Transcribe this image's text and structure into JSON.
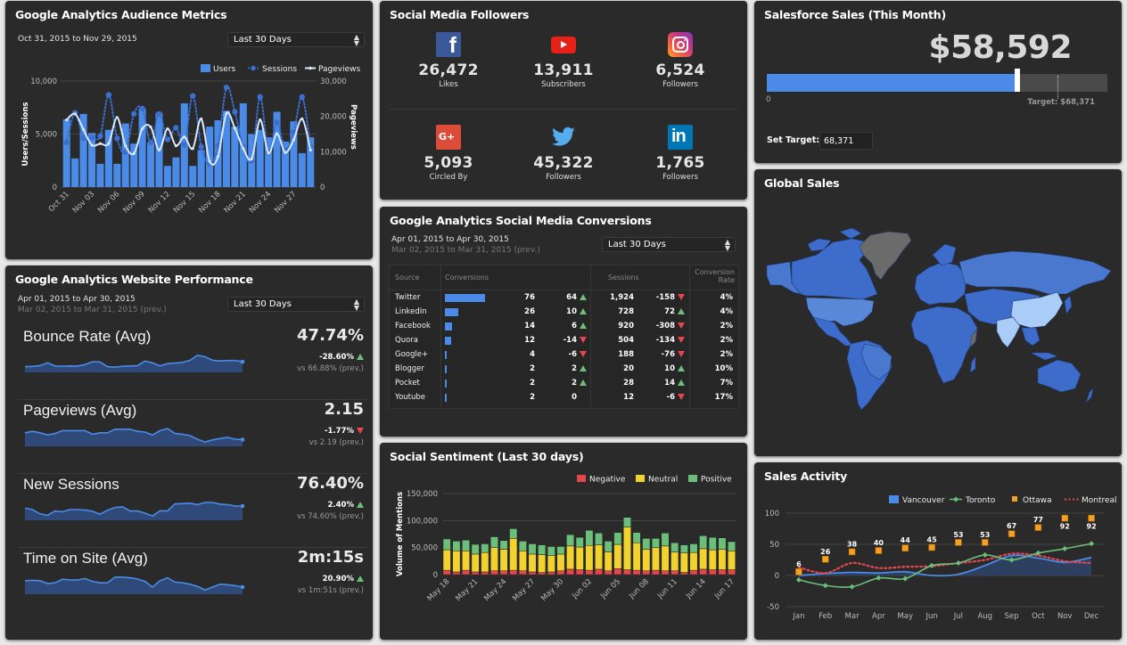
{
  "audience": {
    "title": "Google Analytics Audience Metrics",
    "date_range": "Oct 31, 2015 to  Nov 29, 2015",
    "period_select": "Last 30 Days",
    "chart_data": {
      "type": "bar",
      "title": "Google Analytics Audience Metrics",
      "ylabel": "Users/Sessions",
      "y2label": "Pageviews",
      "ylim": [
        0,
        10000
      ],
      "y2lim": [
        0,
        30000
      ],
      "yticks": [
        "0",
        "5,000",
        "10,000"
      ],
      "y2ticks": [
        "0",
        "10,000",
        "20,000",
        "30,000"
      ],
      "xticks": [
        "Oct 31",
        "Nov 03",
        "Nov 06",
        "Nov 09",
        "Nov 12",
        "Nov 15",
        "Nov 18",
        "Nov 21",
        "Nov 24",
        "Nov 27"
      ],
      "legend": [
        "Users",
        "Sessions",
        "Pageviews"
      ],
      "series": [
        {
          "name": "Users",
          "type": "bar",
          "axis": "left",
          "values": [
            6400,
            2700,
            6900,
            5100,
            2200,
            5400,
            2200,
            6000,
            4100,
            7400,
            4200,
            7000,
            2000,
            2800,
            7900,
            2000,
            3500,
            5700,
            6300,
            7200,
            5700,
            7900,
            5000,
            5400,
            4700,
            7100,
            4300,
            6200,
            3200,
            4700
          ]
        },
        {
          "name": "Sessions",
          "type": "line-dotted",
          "axis": "left",
          "values": [
            4200,
            7000,
            4600,
            4700,
            4800,
            8700,
            4600,
            3300,
            6900,
            7400,
            4200,
            6900,
            4500,
            5600,
            4000,
            8600,
            3800,
            2200,
            3900,
            9400,
            7100,
            3800,
            2500,
            8500,
            3300,
            6100,
            3500,
            5200,
            8500,
            3800
          ]
        },
        {
          "name": "Pageviews",
          "type": "line",
          "axis": "right",
          "values": [
            19000,
            20700,
            16300,
            11900,
            12300,
            12300,
            19700,
            11700,
            9500,
            16500,
            17000,
            10500,
            16500,
            11700,
            14200,
            10900,
            19300,
            7300,
            8600,
            20900,
            16700,
            10900,
            8000,
            19000,
            9600,
            15100,
            9800,
            13400,
            19300,
            10500
          ]
        }
      ]
    }
  },
  "website": {
    "title": "Google Analytics Website Performance",
    "date_range": "Apr 01, 2015 to  Apr 30, 2015",
    "prev_range": "Mar 02, 2015 to Mar 31, 2015 (prev.)",
    "period_select": "Last 30 Days",
    "metrics": [
      {
        "name": "Bounce Rate (Avg)",
        "value": "47.74%",
        "change": "-28.60%",
        "direction": "up",
        "prev": "vs 66.88% (prev.)",
        "trend": [
          0.15,
          0.17,
          0.22,
          0.42,
          0.2,
          0.18,
          0.2,
          0.19,
          0.3,
          0.5,
          0.48,
          0.15,
          0.12,
          0.18,
          0.2,
          0.22,
          0.55,
          0.42,
          0.2,
          0.37,
          0.4,
          0.45,
          0.6,
          0.95,
          0.85,
          0.6,
          0.55,
          0.58,
          0.58,
          0.5
        ]
      },
      {
        "name": "Pageviews (Avg)",
        "value": "2.15",
        "change": "-1.77%",
        "direction": "down",
        "prev": "vs 2.19 (prev.)",
        "trend": [
          0.7,
          0.8,
          0.7,
          0.55,
          0.65,
          0.85,
          0.85,
          0.85,
          0.85,
          0.6,
          0.7,
          0.7,
          0.95,
          0.95,
          0.95,
          0.8,
          0.75,
          0.55,
          0.85,
          1.0,
          0.65,
          0.6,
          0.5,
          0.25,
          0.05,
          0.2,
          0.3,
          0.38,
          0.25,
          0.22
        ]
      },
      {
        "name": "New Sessions",
        "value": "76.40%",
        "change": "2.40%",
        "direction": "up",
        "prev": "vs 74.60% (prev.)",
        "trend": [
          0.6,
          0.5,
          0.2,
          0.1,
          0.4,
          0.35,
          0.5,
          0.5,
          0.47,
          0.38,
          0.18,
          0.45,
          0.65,
          0.7,
          0.4,
          0.4,
          0.25,
          0.05,
          0.42,
          0.4,
          0.9,
          0.92,
          0.95,
          0.85,
          1.0,
          1.0,
          0.88,
          0.85,
          0.75,
          0.75
        ]
      },
      {
        "name": "Time on Site (Avg)",
        "value": "2m:15s",
        "change": "20.90%",
        "direction": "up",
        "prev": "vs 1m:51s (prev.)",
        "trend": [
          0.7,
          0.72,
          0.7,
          0.5,
          0.55,
          0.8,
          0.75,
          0.75,
          0.85,
          0.65,
          0.55,
          0.55,
          0.95,
          0.95,
          0.9,
          0.82,
          0.65,
          0.25,
          0.7,
          0.9,
          0.6,
          0.55,
          0.45,
          0.3,
          0.05,
          0.25,
          0.45,
          0.42,
          0.35,
          0.25
        ]
      }
    ]
  },
  "social_followers": {
    "title": "Social Media Followers",
    "items": [
      {
        "network": "facebook",
        "icon": "facebook-icon",
        "count": "26,472",
        "label": "Likes",
        "color": "#3b5998"
      },
      {
        "network": "youtube",
        "icon": "youtube-icon",
        "count": "13,911",
        "label": "Subscribers",
        "color": "#e62117"
      },
      {
        "network": "instagram",
        "icon": "instagram-icon",
        "count": "6,524",
        "label": "Followers",
        "color": "#c13584"
      },
      {
        "network": "googleplus",
        "icon": "google-plus-icon",
        "count": "5,093",
        "label": "Circled By",
        "color": "#dd4b39"
      },
      {
        "network": "twitter",
        "icon": "twitter-icon",
        "count": "45,322",
        "label": "Followers",
        "color": "#55acee"
      },
      {
        "network": "linkedin",
        "icon": "linkedin-icon",
        "count": "1,765",
        "label": "Followers",
        "color": "#0077b5"
      }
    ]
  },
  "conversions": {
    "title": "Google Analytics Social Media Conversions",
    "date_range": "Apr 01, 2015 to  Apr 30, 2015",
    "prev_range": "Mar 02, 2015 to Mar 31, 2015 (prev.)",
    "period_select": "Last 30 Days",
    "headers": {
      "source": "Source",
      "conversions": "Conversions",
      "sessions": "Sessions",
      "rate_line1": "Conversion",
      "rate_line2": "Rate"
    },
    "rows": [
      {
        "source": "Twitter",
        "conv": 76,
        "conv_label": "76",
        "conv_change": "64",
        "conv_dir": "up",
        "sessions": "1,924",
        "sess_change": "-158",
        "sess_dir": "down",
        "rate": "4%"
      },
      {
        "source": "LinkedIn",
        "conv": 26,
        "conv_label": "26",
        "conv_change": "10",
        "conv_dir": "up",
        "sessions": "728",
        "sess_change": "72",
        "sess_dir": "up",
        "rate": "4%"
      },
      {
        "source": "Facebook",
        "conv": 14,
        "conv_label": "14",
        "conv_change": "6",
        "conv_dir": "up",
        "sessions": "920",
        "sess_change": "-308",
        "sess_dir": "down",
        "rate": "2%"
      },
      {
        "source": "Quora",
        "conv": 12,
        "conv_label": "12",
        "conv_change": "-14",
        "conv_dir": "down",
        "sessions": "504",
        "sess_change": "-134",
        "sess_dir": "down",
        "rate": "2%"
      },
      {
        "source": "Google+",
        "conv": 4,
        "conv_label": "4",
        "conv_change": "-6",
        "conv_dir": "down",
        "sessions": "188",
        "sess_change": "-76",
        "sess_dir": "down",
        "rate": "2%"
      },
      {
        "source": "Blogger",
        "conv": 2,
        "conv_label": "2",
        "conv_change": "2",
        "conv_dir": "up",
        "sessions": "20",
        "sess_change": "10",
        "sess_dir": "up",
        "rate": "10%"
      },
      {
        "source": "Pocket",
        "conv": 2,
        "conv_label": "2",
        "conv_change": "2",
        "conv_dir": "up",
        "sessions": "28",
        "sess_change": "14",
        "sess_dir": "up",
        "rate": "7%"
      },
      {
        "source": "Youtube",
        "conv": 2,
        "conv_label": "2",
        "conv_change": "0",
        "conv_dir": "none",
        "sessions": "12",
        "sess_change": "-6",
        "sess_dir": "down",
        "rate": "17%"
      }
    ]
  },
  "sentiment": {
    "title": "Social Sentiment (Last 30 days)",
    "chart_data": {
      "type": "bar",
      "stacked": true,
      "title": "Social Sentiment (Last 30 days)",
      "ylabel": "Volume of Mentions",
      "ylim": [
        0,
        150000
      ],
      "yticks": [
        "0",
        "50,000",
        "100,000",
        "150,000"
      ],
      "xticks": [
        "May 18",
        "May 21",
        "May 24",
        "May 27",
        "May 30",
        "Jun 02",
        "Jun 05",
        "Jun 08",
        "Jun 11",
        "Jun 14",
        "Jun 17"
      ],
      "legend": [
        "Negative",
        "Neutral",
        "Positive"
      ],
      "colors": {
        "Negative": "#e8454f",
        "Neutral": "#f2d22e",
        "Positive": "#6cbf7b"
      },
      "series": [
        {
          "name": "Negative",
          "values": [
            8000,
            5000,
            8000,
            5000,
            5000,
            7000,
            7000,
            8000,
            7000,
            5000,
            4000,
            5000,
            7000,
            10000,
            9000,
            8000,
            10000,
            7000,
            11000,
            9000,
            8000,
            7000,
            8000,
            7000,
            7000,
            4000,
            8000,
            10000,
            9000,
            9000,
            9000
          ]
        },
        {
          "name": "Neutral",
          "values": [
            38000,
            39000,
            36000,
            33000,
            36000,
            43000,
            40000,
            59000,
            37000,
            33000,
            33000,
            30000,
            31000,
            43000,
            42000,
            46000,
            45000,
            35000,
            45000,
            79000,
            51000,
            40000,
            42000,
            46000,
            35000,
            36000,
            33000,
            38000,
            37000,
            38000,
            35000
          ]
        },
        {
          "name": "Positive",
          "values": [
            20000,
            18000,
            20000,
            18000,
            16000,
            20000,
            16000,
            18000,
            18000,
            19000,
            18000,
            17000,
            14000,
            21000,
            18000,
            28000,
            22000,
            20000,
            22000,
            18000,
            19000,
            20000,
            17000,
            24000,
            17000,
            15000,
            16000,
            24000,
            23000,
            21000,
            17000
          ]
        }
      ]
    }
  },
  "salesforce": {
    "title": "Salesforce Sales (This Month)",
    "value": "$58,592",
    "progress_value": 58592,
    "target_value": 68371,
    "scale_max": 80000,
    "zero_label": "0",
    "target_label": "Target: $68,371",
    "set_target_label": "Set Target:",
    "target_input": "68,371"
  },
  "global_sales": {
    "title": "Global Sales"
  },
  "sales_activity": {
    "title": "Sales Activity",
    "chart_data": {
      "type": "line",
      "title": "Sales Activity",
      "x": [
        "Jan",
        "Feb",
        "Mar",
        "Apr",
        "May",
        "Jun",
        "Jul",
        "Aug",
        "Sep",
        "Oct",
        "Nov",
        "Dec"
      ],
      "ylim": [
        -50,
        100
      ],
      "yticks": [
        "-50",
        "0",
        "50",
        "100"
      ],
      "legend": [
        "Vancouver",
        "Toronto",
        "Ottawa",
        "Montreal"
      ],
      "series": [
        {
          "name": "Vancouver",
          "type": "area",
          "color": "#4a8be8",
          "values": [
            0,
            3,
            5,
            4,
            6,
            0,
            2,
            16,
            32,
            28,
            21,
            29
          ]
        },
        {
          "name": "Toronto",
          "type": "line",
          "color": "#6cbf7b",
          "values": [
            -7,
            -16,
            -18,
            -4,
            -5,
            16,
            20,
            33,
            25,
            36,
            43,
            51
          ]
        },
        {
          "name": "Ottawa",
          "type": "scatter",
          "color": "#f5a020",
          "values": [
            6,
            26,
            38,
            40,
            44,
            45,
            53,
            53,
            67,
            77,
            92,
            92
          ],
          "labels": [
            "6",
            "26",
            "38",
            "40",
            "44",
            "45",
            "53",
            "53",
            "67",
            "77",
            "92",
            "92"
          ]
        },
        {
          "name": "Montreal",
          "type": "line-dotted",
          "color": "#e8454f",
          "values": [
            13,
            4,
            20,
            12,
            14,
            15,
            20,
            25,
            35,
            32,
            23,
            20
          ]
        }
      ]
    }
  }
}
